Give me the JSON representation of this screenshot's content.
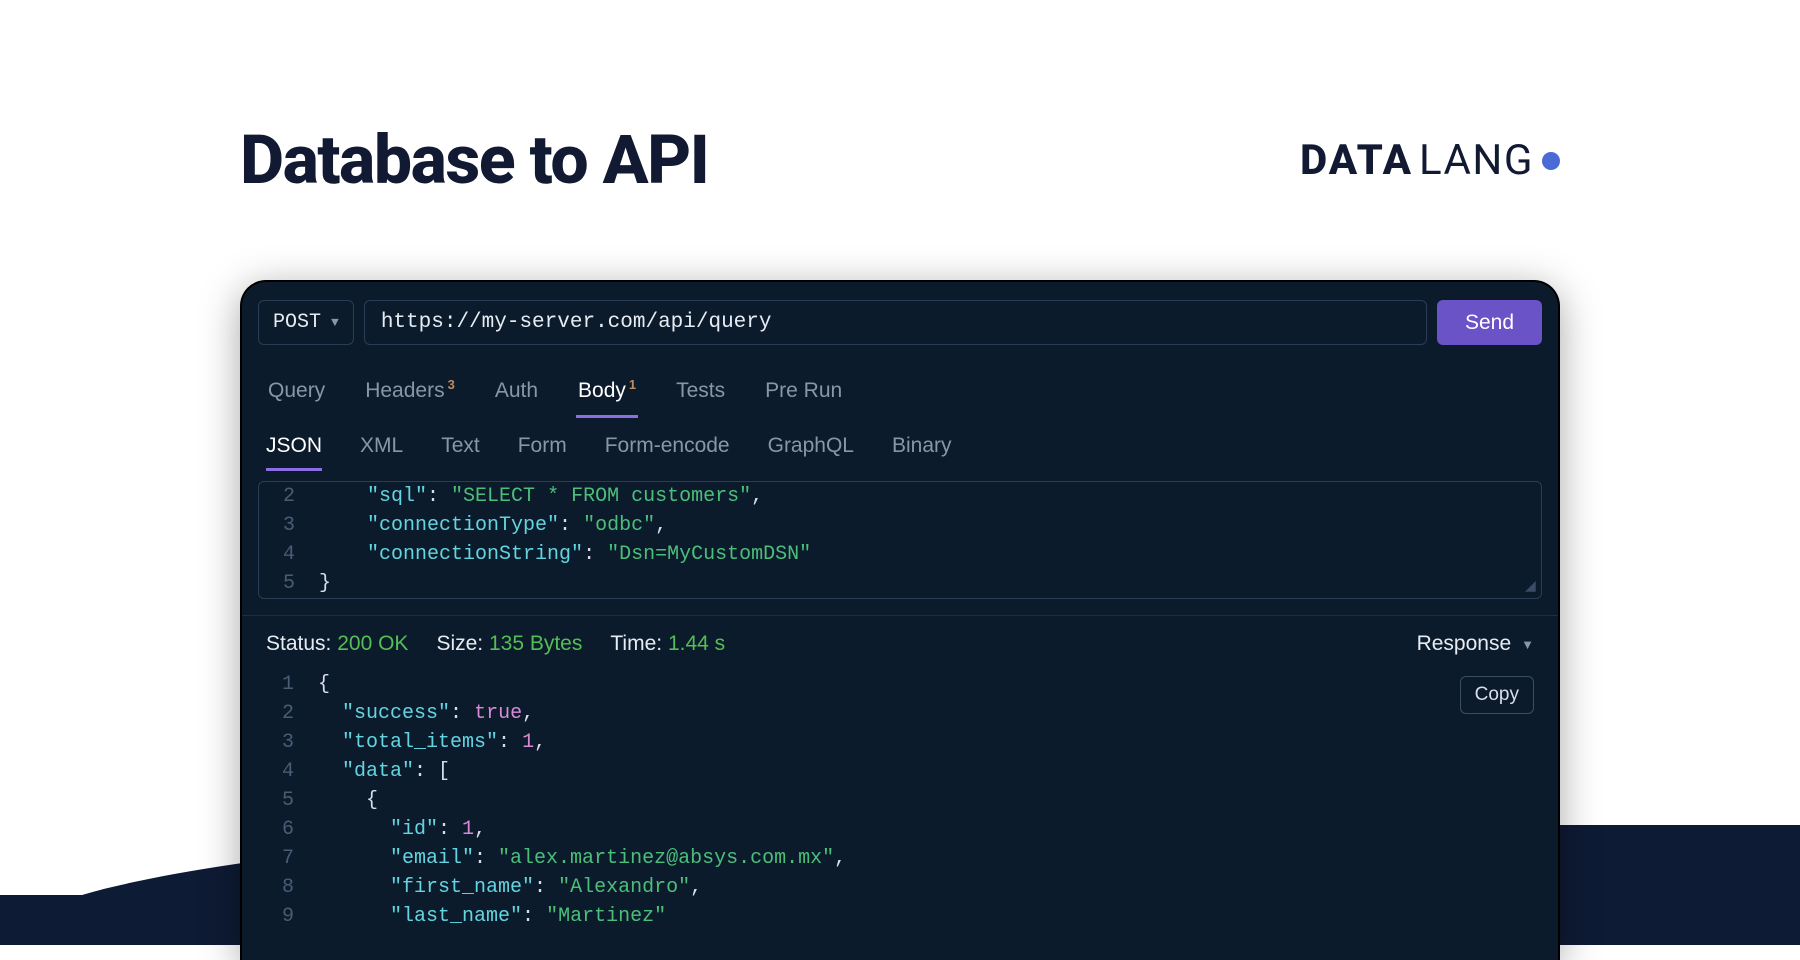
{
  "header": {
    "title": "Database to API",
    "brand_bold": "DATA",
    "brand_light": "LANG"
  },
  "request": {
    "method": "POST",
    "url": "https://my-server.com/api/query",
    "send_label": "Send"
  },
  "tabs": [
    {
      "label": "Query",
      "badge": ""
    },
    {
      "label": "Headers",
      "badge": "3"
    },
    {
      "label": "Auth",
      "badge": ""
    },
    {
      "label": "Body",
      "badge": "1",
      "active": true
    },
    {
      "label": "Tests",
      "badge": ""
    },
    {
      "label": "Pre Run",
      "badge": ""
    }
  ],
  "sub_tabs": [
    {
      "label": "JSON",
      "active": true
    },
    {
      "label": "XML"
    },
    {
      "label": "Text"
    },
    {
      "label": "Form"
    },
    {
      "label": "Form-encode"
    },
    {
      "label": "GraphQL"
    },
    {
      "label": "Binary"
    }
  ],
  "request_body_lines": [
    {
      "num": "2",
      "tokens": [
        {
          "t": "punc",
          "v": "    "
        },
        {
          "t": "key",
          "v": "\"sql\""
        },
        {
          "t": "punc",
          "v": ": "
        },
        {
          "t": "str",
          "v": "\"SELECT * FROM customers\""
        },
        {
          "t": "punc",
          "v": ","
        }
      ]
    },
    {
      "num": "3",
      "tokens": [
        {
          "t": "punc",
          "v": "    "
        },
        {
          "t": "key",
          "v": "\"connectionType\""
        },
        {
          "t": "punc",
          "v": ": "
        },
        {
          "t": "str",
          "v": "\"odbc\""
        },
        {
          "t": "punc",
          "v": ","
        }
      ]
    },
    {
      "num": "4",
      "tokens": [
        {
          "t": "punc",
          "v": "    "
        },
        {
          "t": "key",
          "v": "\"connectionString\""
        },
        {
          "t": "punc",
          "v": ": "
        },
        {
          "t": "str",
          "v": "\"Dsn=MyCustomDSN\""
        }
      ]
    },
    {
      "num": "5",
      "tokens": [
        {
          "t": "punc",
          "v": "}"
        }
      ]
    }
  ],
  "status": {
    "status_label": "Status:",
    "status_value": "200 OK",
    "size_label": "Size:",
    "size_value": "135 Bytes",
    "time_label": "Time:",
    "time_value": "1.44 s",
    "response_label": "Response"
  },
  "copy_label": "Copy",
  "response_body_lines": [
    {
      "num": "1",
      "tokens": [
        {
          "t": "punc",
          "v": "{"
        }
      ]
    },
    {
      "num": "2",
      "tokens": [
        {
          "t": "punc",
          "v": "  "
        },
        {
          "t": "key",
          "v": "\"success\""
        },
        {
          "t": "punc",
          "v": ": "
        },
        {
          "t": "bool",
          "v": "true"
        },
        {
          "t": "punc",
          "v": ","
        }
      ]
    },
    {
      "num": "3",
      "tokens": [
        {
          "t": "punc",
          "v": "  "
        },
        {
          "t": "key",
          "v": "\"total_items\""
        },
        {
          "t": "punc",
          "v": ": "
        },
        {
          "t": "num",
          "v": "1"
        },
        {
          "t": "punc",
          "v": ","
        }
      ]
    },
    {
      "num": "4",
      "tokens": [
        {
          "t": "punc",
          "v": "  "
        },
        {
          "t": "key",
          "v": "\"data\""
        },
        {
          "t": "punc",
          "v": ": ["
        }
      ]
    },
    {
      "num": "5",
      "tokens": [
        {
          "t": "punc",
          "v": "    {"
        }
      ]
    },
    {
      "num": "6",
      "tokens": [
        {
          "t": "punc",
          "v": "      "
        },
        {
          "t": "key",
          "v": "\"id\""
        },
        {
          "t": "punc",
          "v": ": "
        },
        {
          "t": "num",
          "v": "1"
        },
        {
          "t": "punc",
          "v": ","
        }
      ]
    },
    {
      "num": "7",
      "tokens": [
        {
          "t": "punc",
          "v": "      "
        },
        {
          "t": "key",
          "v": "\"email\""
        },
        {
          "t": "punc",
          "v": ": "
        },
        {
          "t": "str",
          "v": "\"alex.martinez@absys.com.mx\""
        },
        {
          "t": "punc",
          "v": ","
        }
      ]
    },
    {
      "num": "8",
      "tokens": [
        {
          "t": "punc",
          "v": "      "
        },
        {
          "t": "key",
          "v": "\"first_name\""
        },
        {
          "t": "punc",
          "v": ": "
        },
        {
          "t": "str",
          "v": "\"Alexandro\""
        },
        {
          "t": "punc",
          "v": ","
        }
      ]
    },
    {
      "num": "9",
      "tokens": [
        {
          "t": "punc",
          "v": "      "
        },
        {
          "t": "key",
          "v": "\"last_name\""
        },
        {
          "t": "punc",
          "v": ": "
        },
        {
          "t": "str",
          "v": "\"Martinez\""
        }
      ]
    }
  ]
}
